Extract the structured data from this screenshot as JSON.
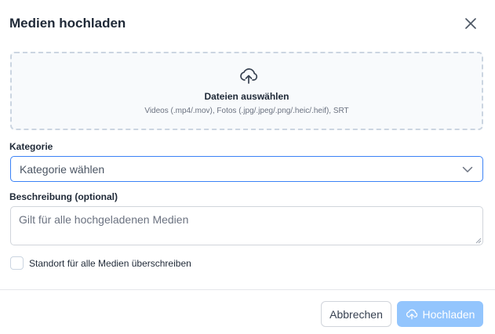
{
  "dialog": {
    "title": "Medien hochladen",
    "close_icon": "close-icon"
  },
  "dropzone": {
    "icon": "cloud-upload-icon",
    "title": "Dateien auswählen",
    "hint": "Videos (.mp4/.mov), Fotos (.jpg/.jpeg/.png/.heic/.heif), SRT"
  },
  "category": {
    "label": "Kategorie",
    "value": "Kategorie wählen",
    "icon": "chevron-down-icon"
  },
  "description": {
    "label": "Beschreibung (optional)",
    "placeholder": "Gilt für alle hochgeladenen Medien",
    "value": ""
  },
  "override_location": {
    "label": "Standort für alle Medien überschreiben",
    "checked": false
  },
  "footer": {
    "cancel_label": "Abbrechen",
    "upload_label": "Hochladen",
    "upload_icon": "cloud-upload-icon"
  },
  "colors": {
    "accent": "#3b82f6",
    "upload_button_disabled": "#93c5fd",
    "dropzone_border": "#cbd5e1",
    "text": "#1f2937",
    "muted": "#6b7280"
  }
}
